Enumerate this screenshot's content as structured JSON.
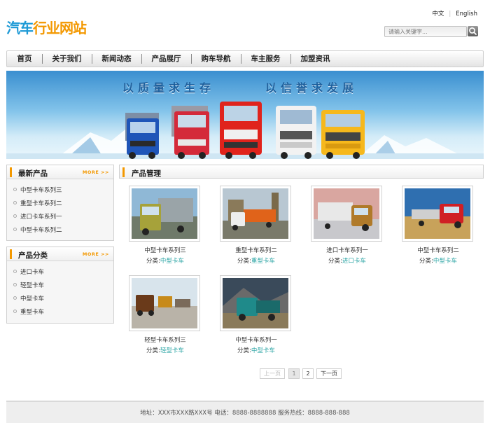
{
  "logo": {
    "part1": "汽车",
    "part2": "行业网站"
  },
  "lang": {
    "zh": "中文",
    "en": "English"
  },
  "search": {
    "placeholder": "请输入关键字..."
  },
  "nav": [
    "首页",
    "关于我们",
    "新闻动态",
    "产品展厅",
    "购车导航",
    "车主服务",
    "加盟资讯"
  ],
  "banner": {
    "slogan1": "以质量求生存",
    "slogan2": "以信誉求发展"
  },
  "sidebar": {
    "more_label": "MORE >>",
    "latest": {
      "title": "最新产品",
      "items": [
        "中型卡车系列三",
        "重型卡车系列二",
        "进口卡车系列一",
        "中型卡车系列二"
      ]
    },
    "category": {
      "title": "产品分类",
      "items": [
        "进口卡车",
        "轻型卡车",
        "中型卡车",
        "重型卡车"
      ]
    }
  },
  "content": {
    "title": "产品管理",
    "category_prefix": "分类:",
    "products": [
      {
        "name": "中型卡车系列三",
        "category": "中型卡车"
      },
      {
        "name": "重型卡车系列二",
        "category": "重型卡车"
      },
      {
        "name": "进口卡车系列一",
        "category": "进口卡车"
      },
      {
        "name": "中型卡车系列二",
        "category": "中型卡车"
      },
      {
        "name": "轻型卡车系列三",
        "category": "轻型卡车"
      },
      {
        "name": "中型卡车系列一",
        "category": "中型卡车"
      }
    ]
  },
  "pagination": {
    "prev": "上一页",
    "pages": [
      "1",
      "2"
    ],
    "current": "1",
    "next": "下一页"
  },
  "footer": {
    "text": "地址：XXX市XXX路XXX号 电话：8888-8888888 服务热线：8888-888-888"
  },
  "colors": {
    "accent_orange": "#f39800",
    "logo_blue": "#1e9ad6",
    "category_link": "#2aa4a4"
  }
}
